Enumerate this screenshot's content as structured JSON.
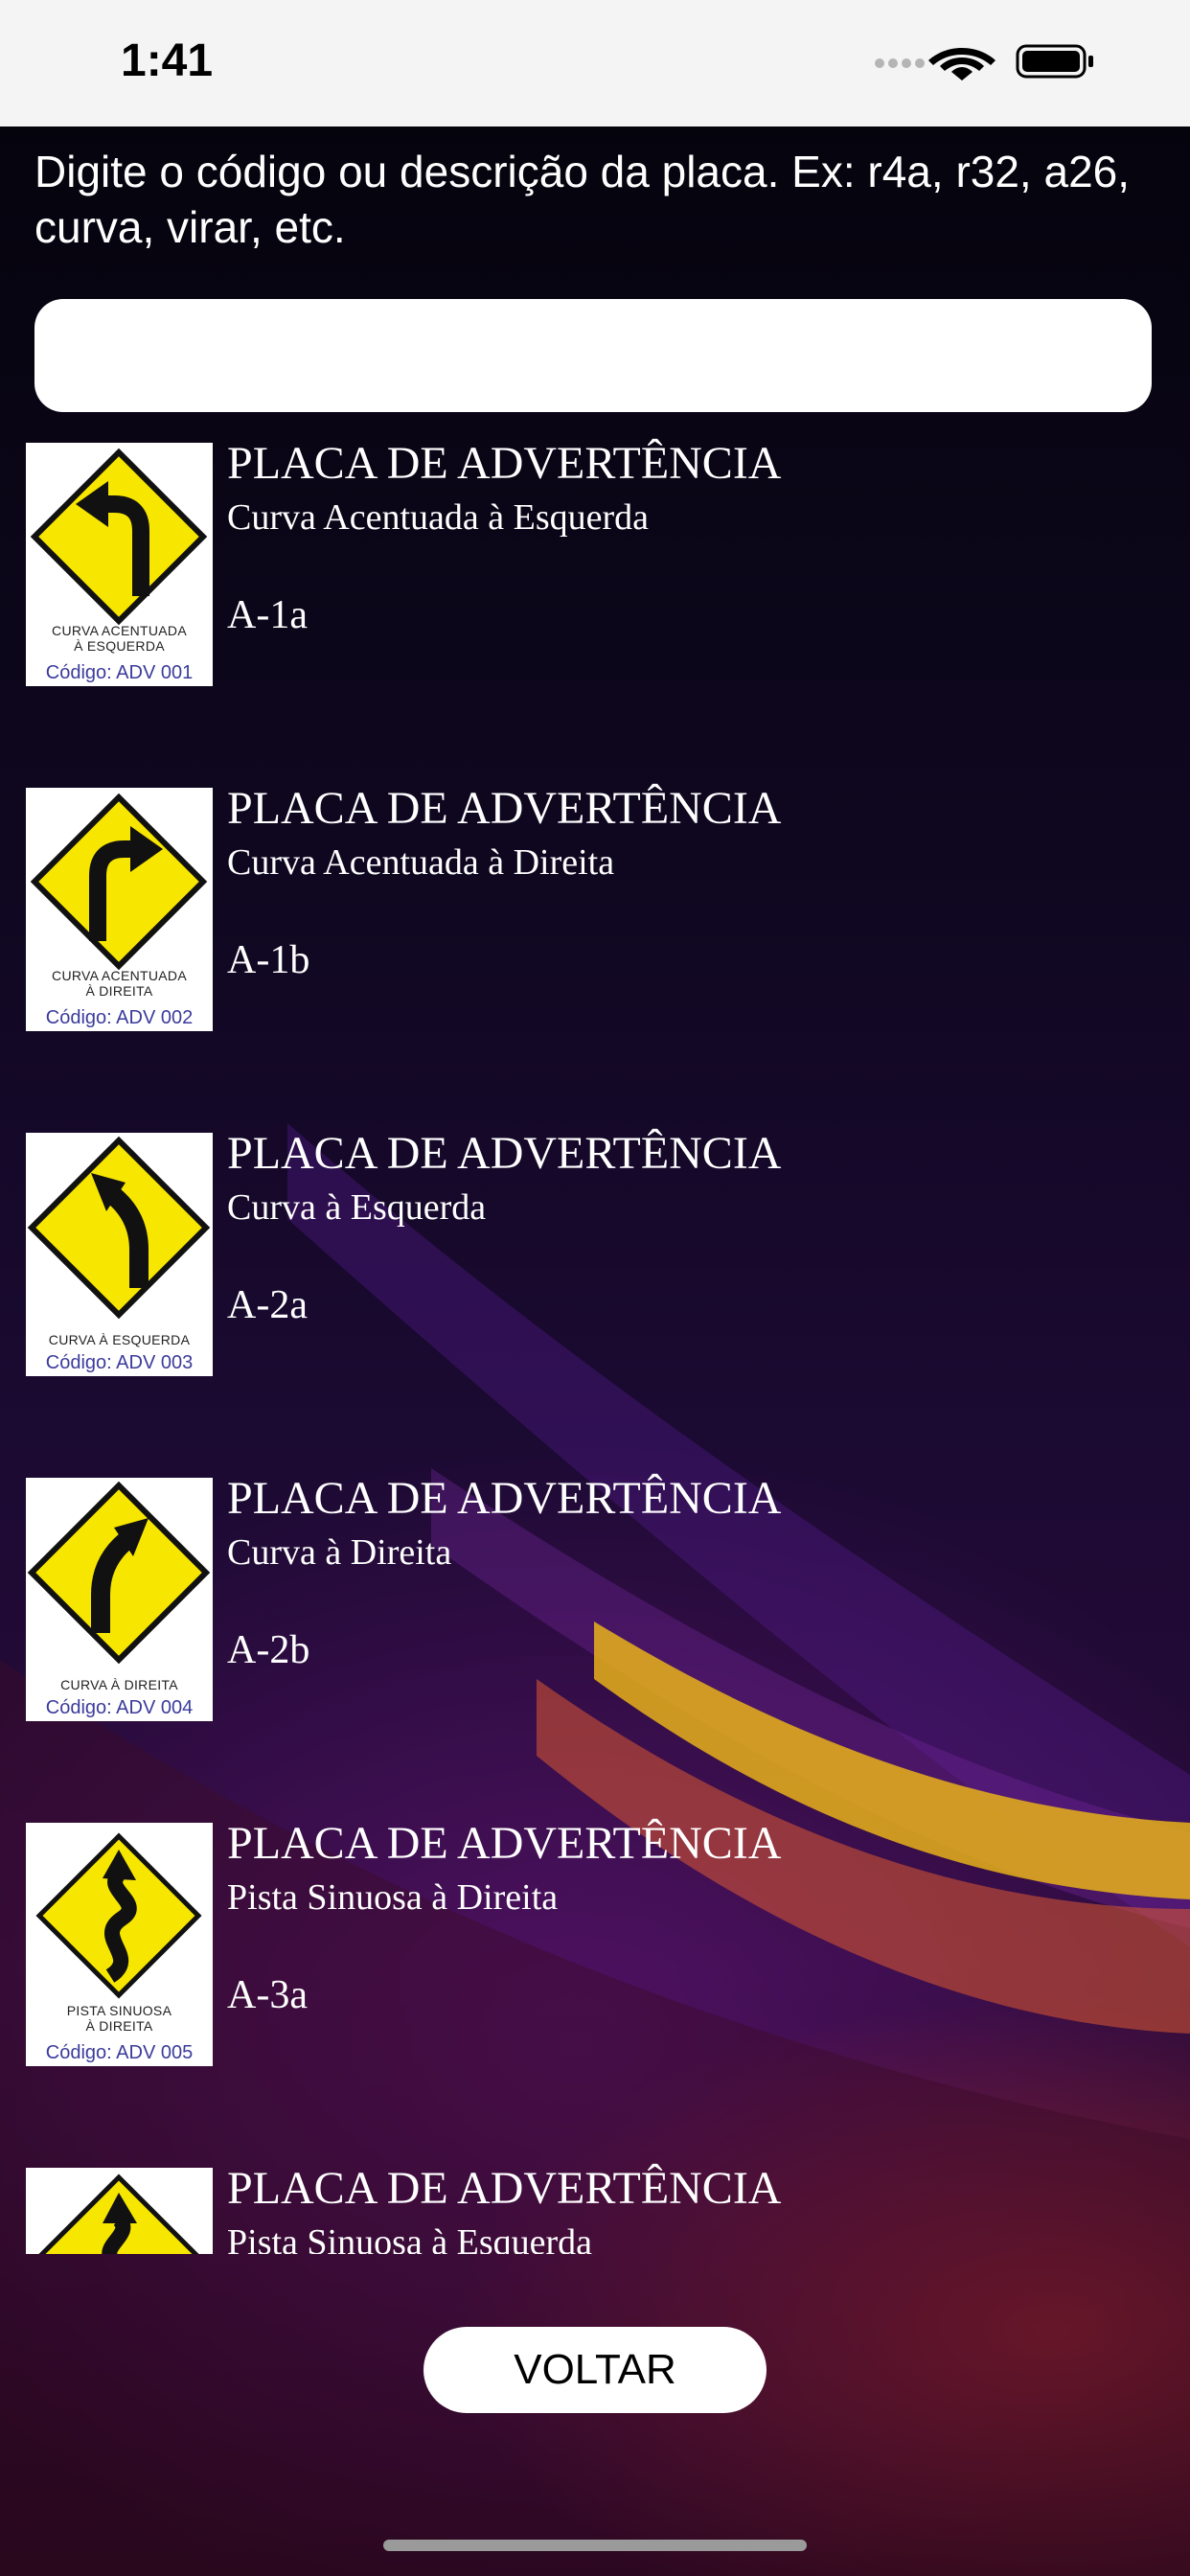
{
  "status_bar": {
    "time": "1:41"
  },
  "search": {
    "prompt": "Digite o código ou descrição da placa. Ex: r4a,  r32, a26, curva, virar, etc.",
    "value": ""
  },
  "signs": [
    {
      "title": "PLACA DE ADVERTÊNCIA",
      "description": "Curva Acentuada à Esquerda",
      "code": "A-1a",
      "icon": "sharp-curve-left-sign-icon",
      "caption_1": "CURVA ACENTUADA",
      "caption_2": "À ESQUERDA",
      "image_code": "Código: ADV 001"
    },
    {
      "title": "PLACA DE ADVERTÊNCIA",
      "description": "Curva Acentuada à Direita",
      "code": "A-1b",
      "icon": "sharp-curve-right-sign-icon",
      "caption_1": "CURVA ACENTUADA",
      "caption_2": "À DIREITA",
      "image_code": "Código: ADV 002"
    },
    {
      "title": "PLACA DE ADVERTÊNCIA",
      "description": "Curva à Esquerda",
      "code": "A-2a",
      "icon": "curve-left-sign-icon",
      "caption_1": "CURVA À ESQUERDA",
      "caption_2": "",
      "image_code": "Código: ADV 003"
    },
    {
      "title": "PLACA DE ADVERTÊNCIA",
      "description": "Curva à Direita",
      "code": "A-2b",
      "icon": "curve-right-sign-icon",
      "caption_1": "CURVA À DIREITA",
      "caption_2": "",
      "image_code": "Código: ADV 004"
    },
    {
      "title": "PLACA DE ADVERTÊNCIA",
      "description": "Pista Sinuosa à Direita",
      "code": "A-3a",
      "icon": "winding-road-right-sign-icon",
      "caption_1": "PISTA SINUOSA",
      "caption_2": "À DIREITA",
      "image_code": "Código: ADV 005"
    },
    {
      "title": "PLACA DE ADVERTÊNCIA",
      "description": "Pista Sinuosa à Esquerda",
      "code": "",
      "icon": "winding-road-left-sign-icon",
      "caption_1": "",
      "caption_2": "",
      "image_code": ""
    }
  ],
  "buttons": {
    "back_label": "VOLTAR"
  },
  "colors": {
    "sign_yellow": "#f7e600",
    "sign_border": "#111111",
    "background_top": "#05040d",
    "background_accent": "#e8b21a"
  }
}
